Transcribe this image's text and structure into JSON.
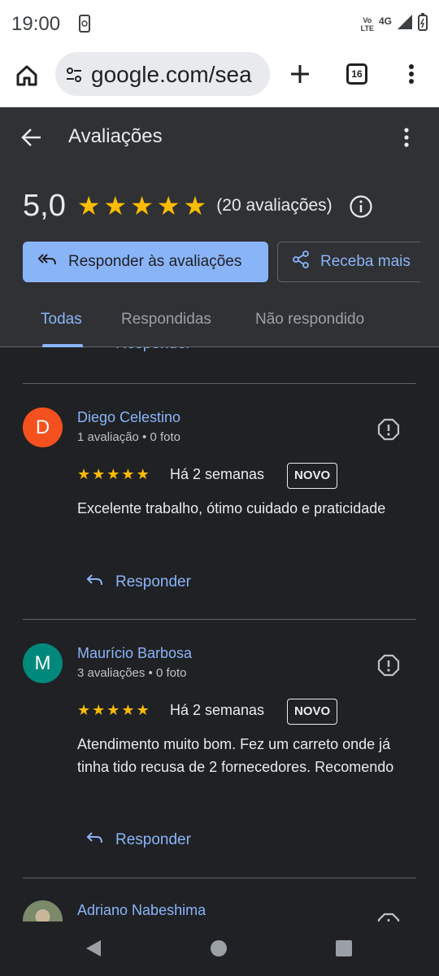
{
  "status": {
    "time": "19:00",
    "lte_top": "Vo",
    "lte_bottom": "LTE",
    "network": "4G"
  },
  "browser": {
    "url": "google.com/sea",
    "tab_count": "16"
  },
  "header": {
    "title": "Avaliações",
    "rating": "5,0",
    "rating_stars": 5,
    "reviews_count": "(20 avaliações)",
    "reply_all_label": "Responder às avaliações",
    "get_more_label": "Receba mais"
  },
  "tabs": [
    {
      "label": "Todas",
      "active": true
    },
    {
      "label": "Respondidas",
      "active": false
    },
    {
      "label": "Não respondido",
      "active": false
    }
  ],
  "reply_label": "Responder",
  "reviews": [
    {
      "initial": "D",
      "avatar_color": "#f4511e",
      "name": "Diego Celestino",
      "meta": "1 avaliação • 0 foto",
      "stars": 5,
      "date": "Há 2 semanas",
      "badge": "NOVO",
      "text": "Excelente trabalho, ótimo cuidado e praticidade"
    },
    {
      "initial": "M",
      "avatar_color": "#00897b",
      "name": "Maurício Barbosa",
      "meta": "3 avaliações • 0 foto",
      "stars": 5,
      "date": "Há 2 semanas",
      "badge": "NOVO",
      "text": "Atendimento muito bom. Fez um carreto onde já tinha tido recusa de 2 fornecedores. Recomendo"
    },
    {
      "initial": "",
      "avatar_color": "#7a8a6a",
      "name": "Adriano Nabeshima"
    }
  ],
  "colors": {
    "accent": "#8ab4f8",
    "star": "#fbbc04",
    "background": "#202124",
    "header_bg": "#303134"
  }
}
